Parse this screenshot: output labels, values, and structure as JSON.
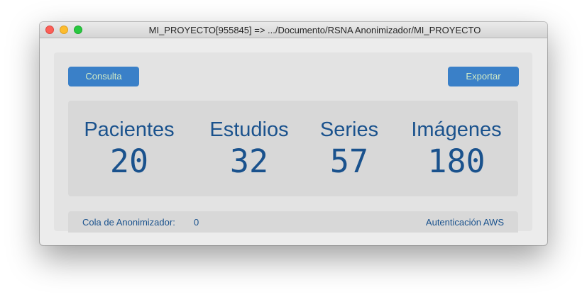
{
  "window": {
    "title": "MI_PROYECTO[955845] => .../Documento/RSNA Anonimizador/MI_PROYECTO"
  },
  "toolbar": {
    "consulta_label": "Consulta",
    "exportar_label": "Exportar"
  },
  "stats": [
    {
      "label": "Pacientes",
      "value": "20"
    },
    {
      "label": "Estudios",
      "value": "32"
    },
    {
      "label": "Series",
      "value": "57"
    },
    {
      "label": "Imágenes",
      "value": "180"
    }
  ],
  "status": {
    "queue_label": "Cola de Anonimizador:",
    "queue_count": "0",
    "aws_label": "Autenticación AWS"
  },
  "colors": {
    "accent_button": "#3a80c8",
    "button_text": "#d3ebc6",
    "stat_text": "#1a528d"
  }
}
